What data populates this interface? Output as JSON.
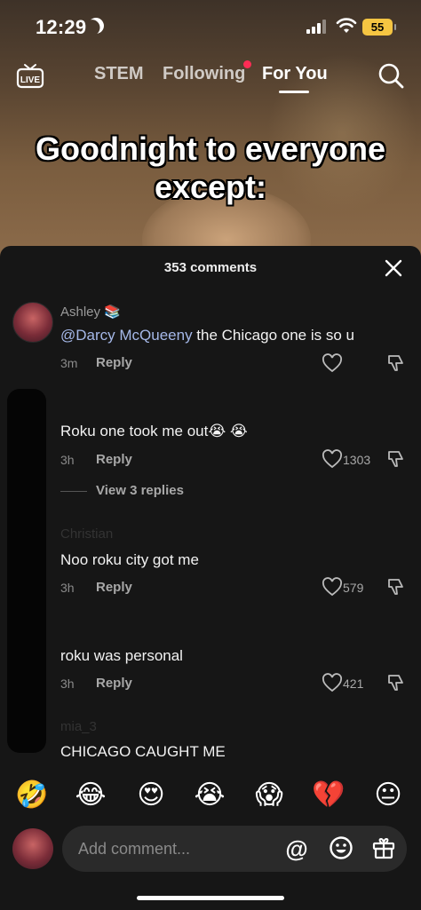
{
  "status_bar": {
    "time": "12:29",
    "battery": "55"
  },
  "top_nav": {
    "live_label": "LIVE",
    "tabs": [
      {
        "label": "STEM"
      },
      {
        "label": "Following"
      },
      {
        "label": "For You"
      }
    ]
  },
  "video": {
    "caption": "Goodnight to everyone except:"
  },
  "comments_sheet": {
    "count_label": "353 comments",
    "comments": [
      {
        "user": "Ashley 📚",
        "mention": "@Darcy McQueeny",
        "text": " the Chicago one is so u",
        "time": "3m",
        "reply_label": "Reply",
        "likes": ""
      },
      {
        "user": "",
        "text": "Roku one took me out😭 😭",
        "time": "3h",
        "reply_label": "Reply",
        "likes": "1303",
        "view_replies": "View 3 replies"
      },
      {
        "user": "Christian",
        "text": "Noo roku city got me",
        "time": "3h",
        "reply_label": "Reply",
        "likes": "579"
      },
      {
        "user": "",
        "text": "roku was personal",
        "time": "3h",
        "reply_label": "Reply",
        "likes": "421"
      },
      {
        "user": "mia_3",
        "text": "CHICAGO CAUGHT ME",
        "time": "",
        "reply_label": "",
        "likes": ""
      }
    ]
  },
  "emoji_bar": [
    "🤣",
    "😂",
    "😍",
    "😭",
    "😱",
    "💔",
    "😐"
  ],
  "comment_input": {
    "placeholder": "Add comment...",
    "at_symbol": "@"
  },
  "icons": {
    "live": "live-tv-icon",
    "search": "search-icon",
    "close": "close-icon",
    "like": "heart-icon",
    "dislike": "thumbs-down-icon",
    "emoji": "smiley-icon",
    "gift": "gift-icon"
  },
  "colors": {
    "accent": "#fe2c55",
    "mention": "#a5b8e8",
    "sheet_bg": "#161616",
    "battery": "#f5c542"
  }
}
